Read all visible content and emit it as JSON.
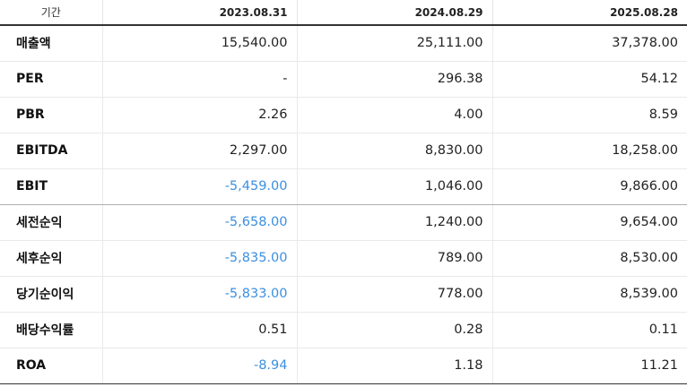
{
  "table": {
    "header": {
      "label": "기간",
      "periods": [
        "2023.08.31",
        "2024.08.29",
        "2025.08.28"
      ]
    },
    "rows": [
      {
        "label": "매출액",
        "values": [
          "15,540.00",
          "25,111.00",
          "37,378.00"
        ]
      },
      {
        "label": "PER",
        "values": [
          "-",
          "296.38",
          "54.12"
        ]
      },
      {
        "label": "PBR",
        "values": [
          "2.26",
          "4.00",
          "8.59"
        ]
      },
      {
        "label": "EBITDA",
        "values": [
          "2,297.00",
          "8,830.00",
          "18,258.00"
        ]
      },
      {
        "label": "EBIT",
        "values": [
          "-5,459.00",
          "1,046.00",
          "9,866.00"
        ]
      },
      {
        "label": "세전순익",
        "values": [
          "-5,658.00",
          "1,240.00",
          "9,654.00"
        ]
      },
      {
        "label": "세후순익",
        "values": [
          "-5,835.00",
          "789.00",
          "8,530.00"
        ]
      },
      {
        "label": "당기순이익",
        "values": [
          "-5,833.00",
          "778.00",
          "8,539.00"
        ]
      },
      {
        "label": "배당수익률",
        "values": [
          "0.51",
          "0.28",
          "0.11"
        ]
      },
      {
        "label": "ROA",
        "values": [
          "-8.94",
          "1.18",
          "11.21"
        ]
      }
    ]
  },
  "colors": {
    "negative_value": "#3b8fe0",
    "header_rule": "#333333"
  }
}
